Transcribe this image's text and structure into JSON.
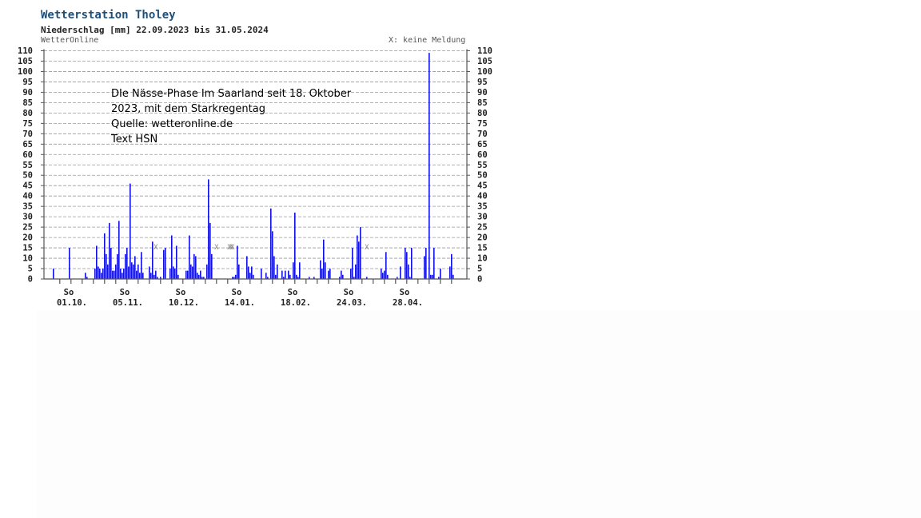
{
  "header": {
    "title": "Wetterstation Tholey",
    "subtitle": "Niederschlag [mm] 22.09.2023 bis 31.05.2024",
    "source": "WetterOnline",
    "legend_note": "X: keine Meldung"
  },
  "annotation": {
    "lines": [
      "DIe Nässe-Phase Im Saarland seit 18. Oktober",
      "2023, mit dem Starkregentag",
      "Quelle: wetteronline.de",
      "Text HSN"
    ]
  },
  "colors": {
    "bar": "#1010e0",
    "grid": "#999999",
    "axis": "#555555",
    "title": "#1f4f78"
  },
  "chart_data": {
    "type": "bar",
    "title": "Wetterstation Tholey",
    "subtitle": "Niederschlag [mm] 22.09.2023 bis 31.05.2024",
    "ylabel": "",
    "xlabel": "",
    "ylim": [
      0,
      110
    ],
    "y_ticks": [
      0,
      5,
      10,
      15,
      20,
      25,
      30,
      35,
      40,
      45,
      50,
      55,
      60,
      65,
      70,
      75,
      80,
      85,
      90,
      95,
      100,
      105,
      110
    ],
    "grid": true,
    "start_date": "22.09.2023",
    "end_date": "31.05.2024",
    "x_tick_labels": [
      {
        "day_index": 9,
        "weekday": "So",
        "date": "01.10."
      },
      {
        "day_index": 44,
        "weekday": "So",
        "date": "05.11."
      },
      {
        "day_index": 79,
        "weekday": "So",
        "date": "10.12."
      },
      {
        "day_index": 114,
        "weekday": "So",
        "date": "14.01."
      },
      {
        "day_index": 149,
        "weekday": "So",
        "date": "18.02."
      },
      {
        "day_index": 184,
        "weekday": "So",
        "date": "24.03."
      },
      {
        "day_index": 219,
        "weekday": "So",
        "date": "28.04."
      }
    ],
    "no_report_marker": "X",
    "no_report_days": [
      69,
      107,
      115,
      116,
      117,
      201
    ],
    "values": [
      0,
      0,
      0,
      0,
      0,
      5,
      0,
      0,
      0,
      0,
      0,
      0,
      0,
      0,
      0,
      15,
      0,
      0,
      0,
      0,
      0,
      0,
      0,
      0,
      0,
      3,
      1,
      0,
      0,
      0,
      0,
      5,
      16,
      6,
      5,
      3,
      5,
      22,
      12,
      7,
      27,
      15,
      4,
      4,
      7,
      12,
      28,
      5,
      3,
      5,
      12,
      15,
      6,
      46,
      8,
      7,
      11,
      4,
      7,
      3,
      13,
      3,
      0,
      0,
      0,
      6,
      3,
      18,
      2,
      4,
      1,
      0,
      1,
      0,
      14,
      15,
      0,
      0,
      5,
      21,
      6,
      5,
      16,
      2,
      0,
      0,
      0,
      0,
      4,
      4,
      21,
      7,
      6,
      12,
      11,
      3,
      2,
      4,
      1,
      1,
      0,
      7,
      48,
      27,
      12,
      0,
      0,
      0,
      0,
      0,
      0,
      0,
      0,
      0,
      0,
      0,
      0,
      1,
      1,
      2,
      16,
      7,
      0,
      0,
      0,
      0,
      11,
      6,
      3,
      6,
      2,
      0,
      0,
      0,
      0,
      5,
      0,
      0,
      3,
      1,
      0,
      34,
      23,
      11,
      2,
      7,
      0,
      0,
      4,
      1,
      4,
      0,
      4,
      2,
      0,
      8,
      32,
      2,
      1,
      8,
      0,
      0,
      0,
      0,
      0,
      1,
      0,
      0,
      1,
      0,
      0,
      0,
      9,
      5,
      19,
      8,
      0,
      4,
      5,
      0,
      0,
      0,
      0,
      0,
      1,
      4,
      2,
      0,
      0,
      0,
      0,
      5,
      15,
      1,
      7,
      21,
      18,
      25,
      0,
      0,
      0,
      1,
      0,
      0,
      0,
      0,
      0,
      0,
      0,
      0,
      5,
      3,
      4,
      13,
      2,
      0,
      0,
      0,
      0,
      0,
      1,
      0,
      6,
      0,
      0,
      15,
      13,
      7,
      1,
      15,
      0,
      0,
      0,
      0,
      0,
      0,
      0,
      11,
      15,
      0,
      109,
      2,
      2,
      15,
      0,
      0,
      1,
      5,
      0,
      0,
      0,
      0,
      0,
      6,
      12,
      2,
      0,
      0,
      0,
      0
    ]
  }
}
